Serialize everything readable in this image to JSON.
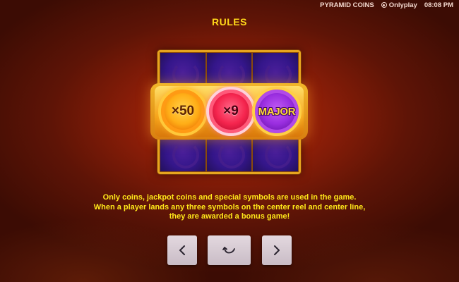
{
  "topbar": {
    "game_name": "PYRAMID COINS",
    "provider": "Onlyplay",
    "time": "08:08 PM"
  },
  "title": "RULES",
  "board": {
    "center_row": [
      {
        "label": "×50",
        "type": "gold-coin"
      },
      {
        "label": "×9",
        "type": "red-coin"
      },
      {
        "label": "MAJOR",
        "type": "purple-jackpot-coin"
      }
    ]
  },
  "rules_lines": [
    "Only coins, jackpot coins and special symbols are used in the game.",
    "When a player lands any three symbols on the center reel and center line,",
    "they are awarded a bonus game!"
  ],
  "nav": {
    "prev_icon": "chevron-left-icon",
    "back_icon": "return-arrow-icon",
    "next_icon": "chevron-right-icon"
  },
  "colors": {
    "title": "#ffd81a",
    "rules_text": "#ffe81a",
    "board_frame": "#e7a51f",
    "cell": "#34168a"
  }
}
